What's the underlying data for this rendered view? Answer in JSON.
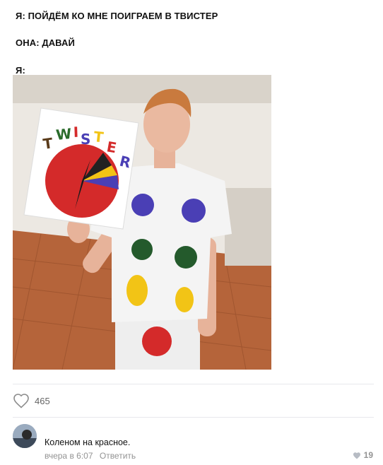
{
  "meme": {
    "line1": "Я: ПОЙДЁМ КО МНЕ ПОИГРАЕМ В ТВИСТЕР",
    "line2": "ОНА: ДАВАЙ",
    "line3": "Я:",
    "sign_text": "TWISTER"
  },
  "post": {
    "likes_count": "465"
  },
  "comment": {
    "text": "Коленом на красное.",
    "time": "вчера в 6:07",
    "reply_label": "Ответить",
    "likes": "19"
  },
  "colors": {
    "red": "#d42a2a",
    "blue": "#4a3fb5",
    "green": "#245a2c",
    "yellow": "#f2c416"
  }
}
